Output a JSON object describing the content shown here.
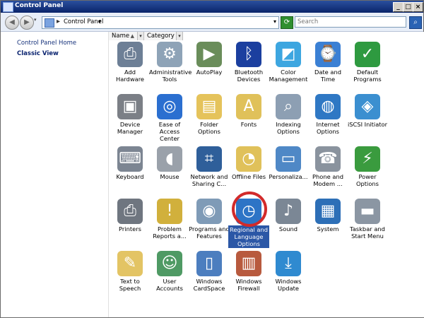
{
  "window": {
    "title": "Control Panel"
  },
  "address": {
    "path_label": "Control Panel",
    "search_placeholder": "Search"
  },
  "sidebar": {
    "items": [
      {
        "label": "Control Panel Home",
        "active": false
      },
      {
        "label": "Classic View",
        "active": true
      }
    ]
  },
  "columns": [
    {
      "label": "Name"
    },
    {
      "label": "Category"
    }
  ],
  "items": [
    {
      "label": "Add Hardware",
      "icon": "hardware-icon",
      "color": "#6d7f96"
    },
    {
      "label": "Administrative Tools",
      "icon": "admin-tools-icon",
      "color": "#8ea3b7"
    },
    {
      "label": "AutoPlay",
      "icon": "autoplay-icon",
      "color": "#6a8d5a"
    },
    {
      "label": "Bluetooth Devices",
      "icon": "bluetooth-icon",
      "color": "#1b3f9f"
    },
    {
      "label": "Color Management",
      "icon": "color-icon",
      "color": "#3da6e0"
    },
    {
      "label": "Date and Time",
      "icon": "calendar-icon",
      "color": "#3b80d4"
    },
    {
      "label": "Default Programs",
      "icon": "default-programs-icon",
      "color": "#2e9a40"
    },
    {
      "label": "Device Manager",
      "icon": "device-manager-icon",
      "color": "#7b7f86"
    },
    {
      "label": "Ease of Access Center",
      "icon": "ease-icon",
      "color": "#2b6fd0"
    },
    {
      "label": "Folder Options",
      "icon": "folder-icon",
      "color": "#e5c35b"
    },
    {
      "label": "Fonts",
      "icon": "fonts-icon",
      "color": "#e0c15a"
    },
    {
      "label": "Indexing Options",
      "icon": "indexing-icon",
      "color": "#8d9fb3"
    },
    {
      "label": "Internet Options",
      "icon": "internet-icon",
      "color": "#2f78c4"
    },
    {
      "label": "iSCSI Initiator",
      "icon": "iscsi-icon",
      "color": "#3b8fd0"
    },
    {
      "label": "Keyboard",
      "icon": "keyboard-icon",
      "color": "#7c8592"
    },
    {
      "label": "Mouse",
      "icon": "mouse-icon",
      "color": "#9aa1aa"
    },
    {
      "label": "Network and Sharing C...",
      "icon": "network-icon",
      "color": "#2f5f9a"
    },
    {
      "label": "Offline Files",
      "icon": "offline-files-icon",
      "color": "#e0c15a"
    },
    {
      "label": "Personaliza...",
      "icon": "personalize-icon",
      "color": "#4f88c6"
    },
    {
      "label": "Phone and Modem ...",
      "icon": "phone-icon",
      "color": "#8a939e"
    },
    {
      "label": "Power Options",
      "icon": "power-icon",
      "color": "#3a9b3e"
    },
    {
      "label": "Printers",
      "icon": "printer-icon",
      "color": "#6f7680"
    },
    {
      "label": "Problem Reports a...",
      "icon": "problem-icon",
      "color": "#d1b03c"
    },
    {
      "label": "Programs and Features",
      "icon": "programs-icon",
      "color": "#7f9bb7"
    },
    {
      "label": "Regional and Language Options",
      "icon": "globe-clock-icon",
      "color": "#2d74c6",
      "selected": true
    },
    {
      "label": "Sound",
      "icon": "sound-icon",
      "color": "#7b8795"
    },
    {
      "label": "System",
      "icon": "system-icon",
      "color": "#2d6fb7"
    },
    {
      "label": "Taskbar and Start Menu",
      "icon": "taskbar-icon",
      "color": "#8b96a3"
    },
    {
      "label": "Text to Speech",
      "icon": "speech-icon",
      "color": "#e3c464"
    },
    {
      "label": "User Accounts",
      "icon": "users-icon",
      "color": "#4f9a64"
    },
    {
      "label": "Windows CardSpace",
      "icon": "cardspace-icon",
      "color": "#4c7ebf"
    },
    {
      "label": "Windows Firewall",
      "icon": "firewall-icon",
      "color": "#b85a3e"
    },
    {
      "label": "Windows Update",
      "icon": "update-icon",
      "color": "#2f8ad0"
    }
  ]
}
